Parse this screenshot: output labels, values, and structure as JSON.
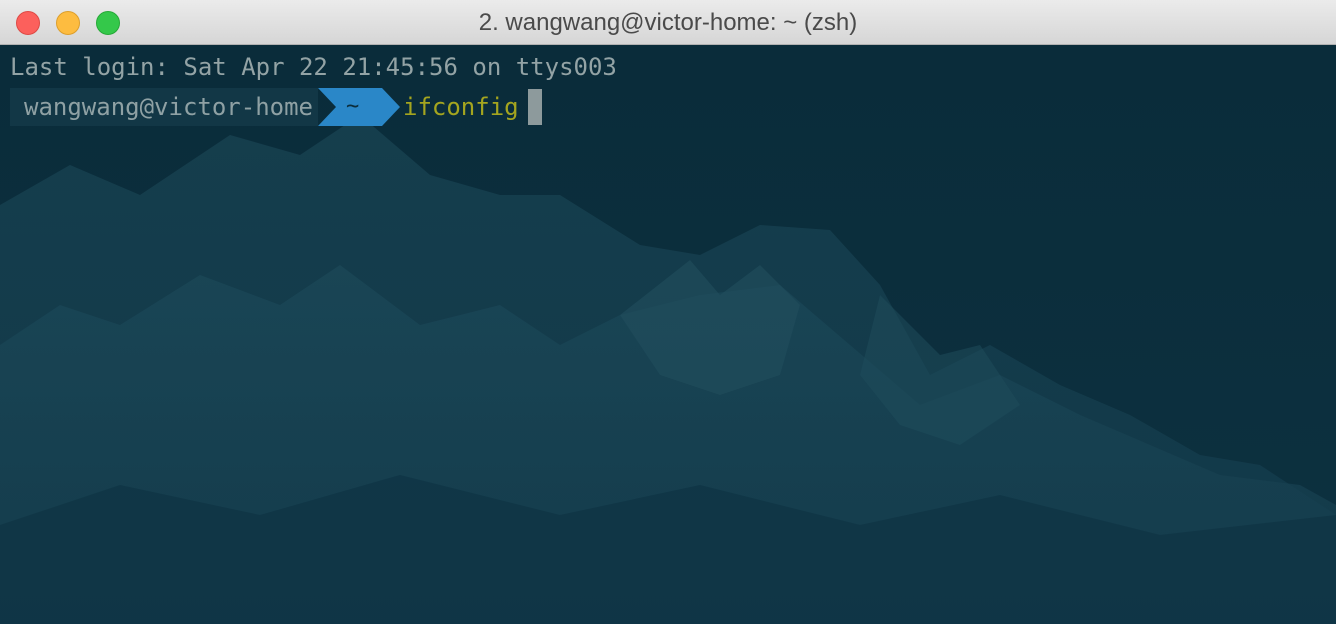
{
  "window": {
    "title": "2. wangwang@victor-home: ~ (zsh)"
  },
  "terminal": {
    "last_login": "Last login: Sat Apr 22 21:45:56 on ttys003",
    "prompt": {
      "user_host": "wangwang@victor-home",
      "directory": "~",
      "command": "ifconfig"
    }
  },
  "colors": {
    "background": "#0b2d3b",
    "prompt_user_bg": "#123746",
    "prompt_dir_bg": "#2a87c8",
    "command_text": "#a4a51f",
    "muted_text": "#93a3a5"
  },
  "icons": {
    "close": "close-traffic-light",
    "minimize": "minimize-traffic-light",
    "zoom": "zoom-traffic-light"
  }
}
